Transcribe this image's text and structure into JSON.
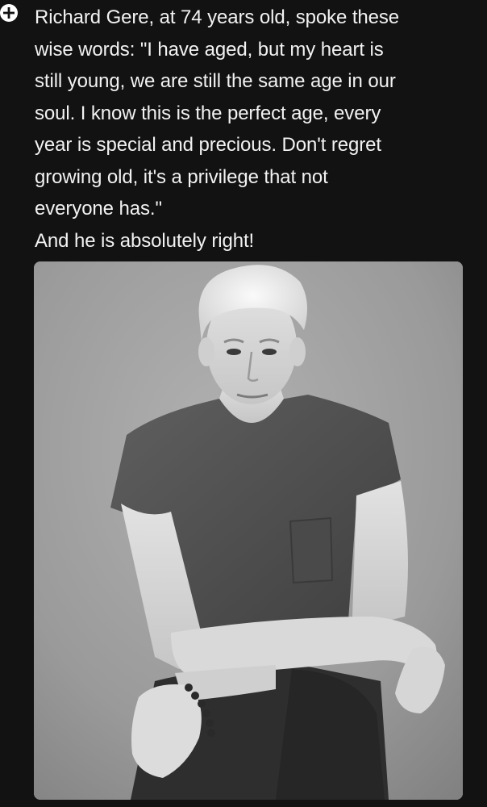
{
  "post": {
    "add_icon": "plus-circle-icon",
    "text": "Richard Gere, at 74 years old, spoke these\nwise words: \"I have aged, but my heart is\nstill young, we are still the same age in our\nsoul. I know this is the perfect age, every\nyear is special and precious. Don't regret\ngrowing old, it's a privilege that not\neveryone has.\"\nAnd he is absolutely right!"
  },
  "photo": {
    "subject": "black-and-white portrait of a grey-haired man in a t-shirt, arms crossed on his knee"
  },
  "colors": {
    "background": "#121212",
    "text": "#f2f2f2"
  }
}
